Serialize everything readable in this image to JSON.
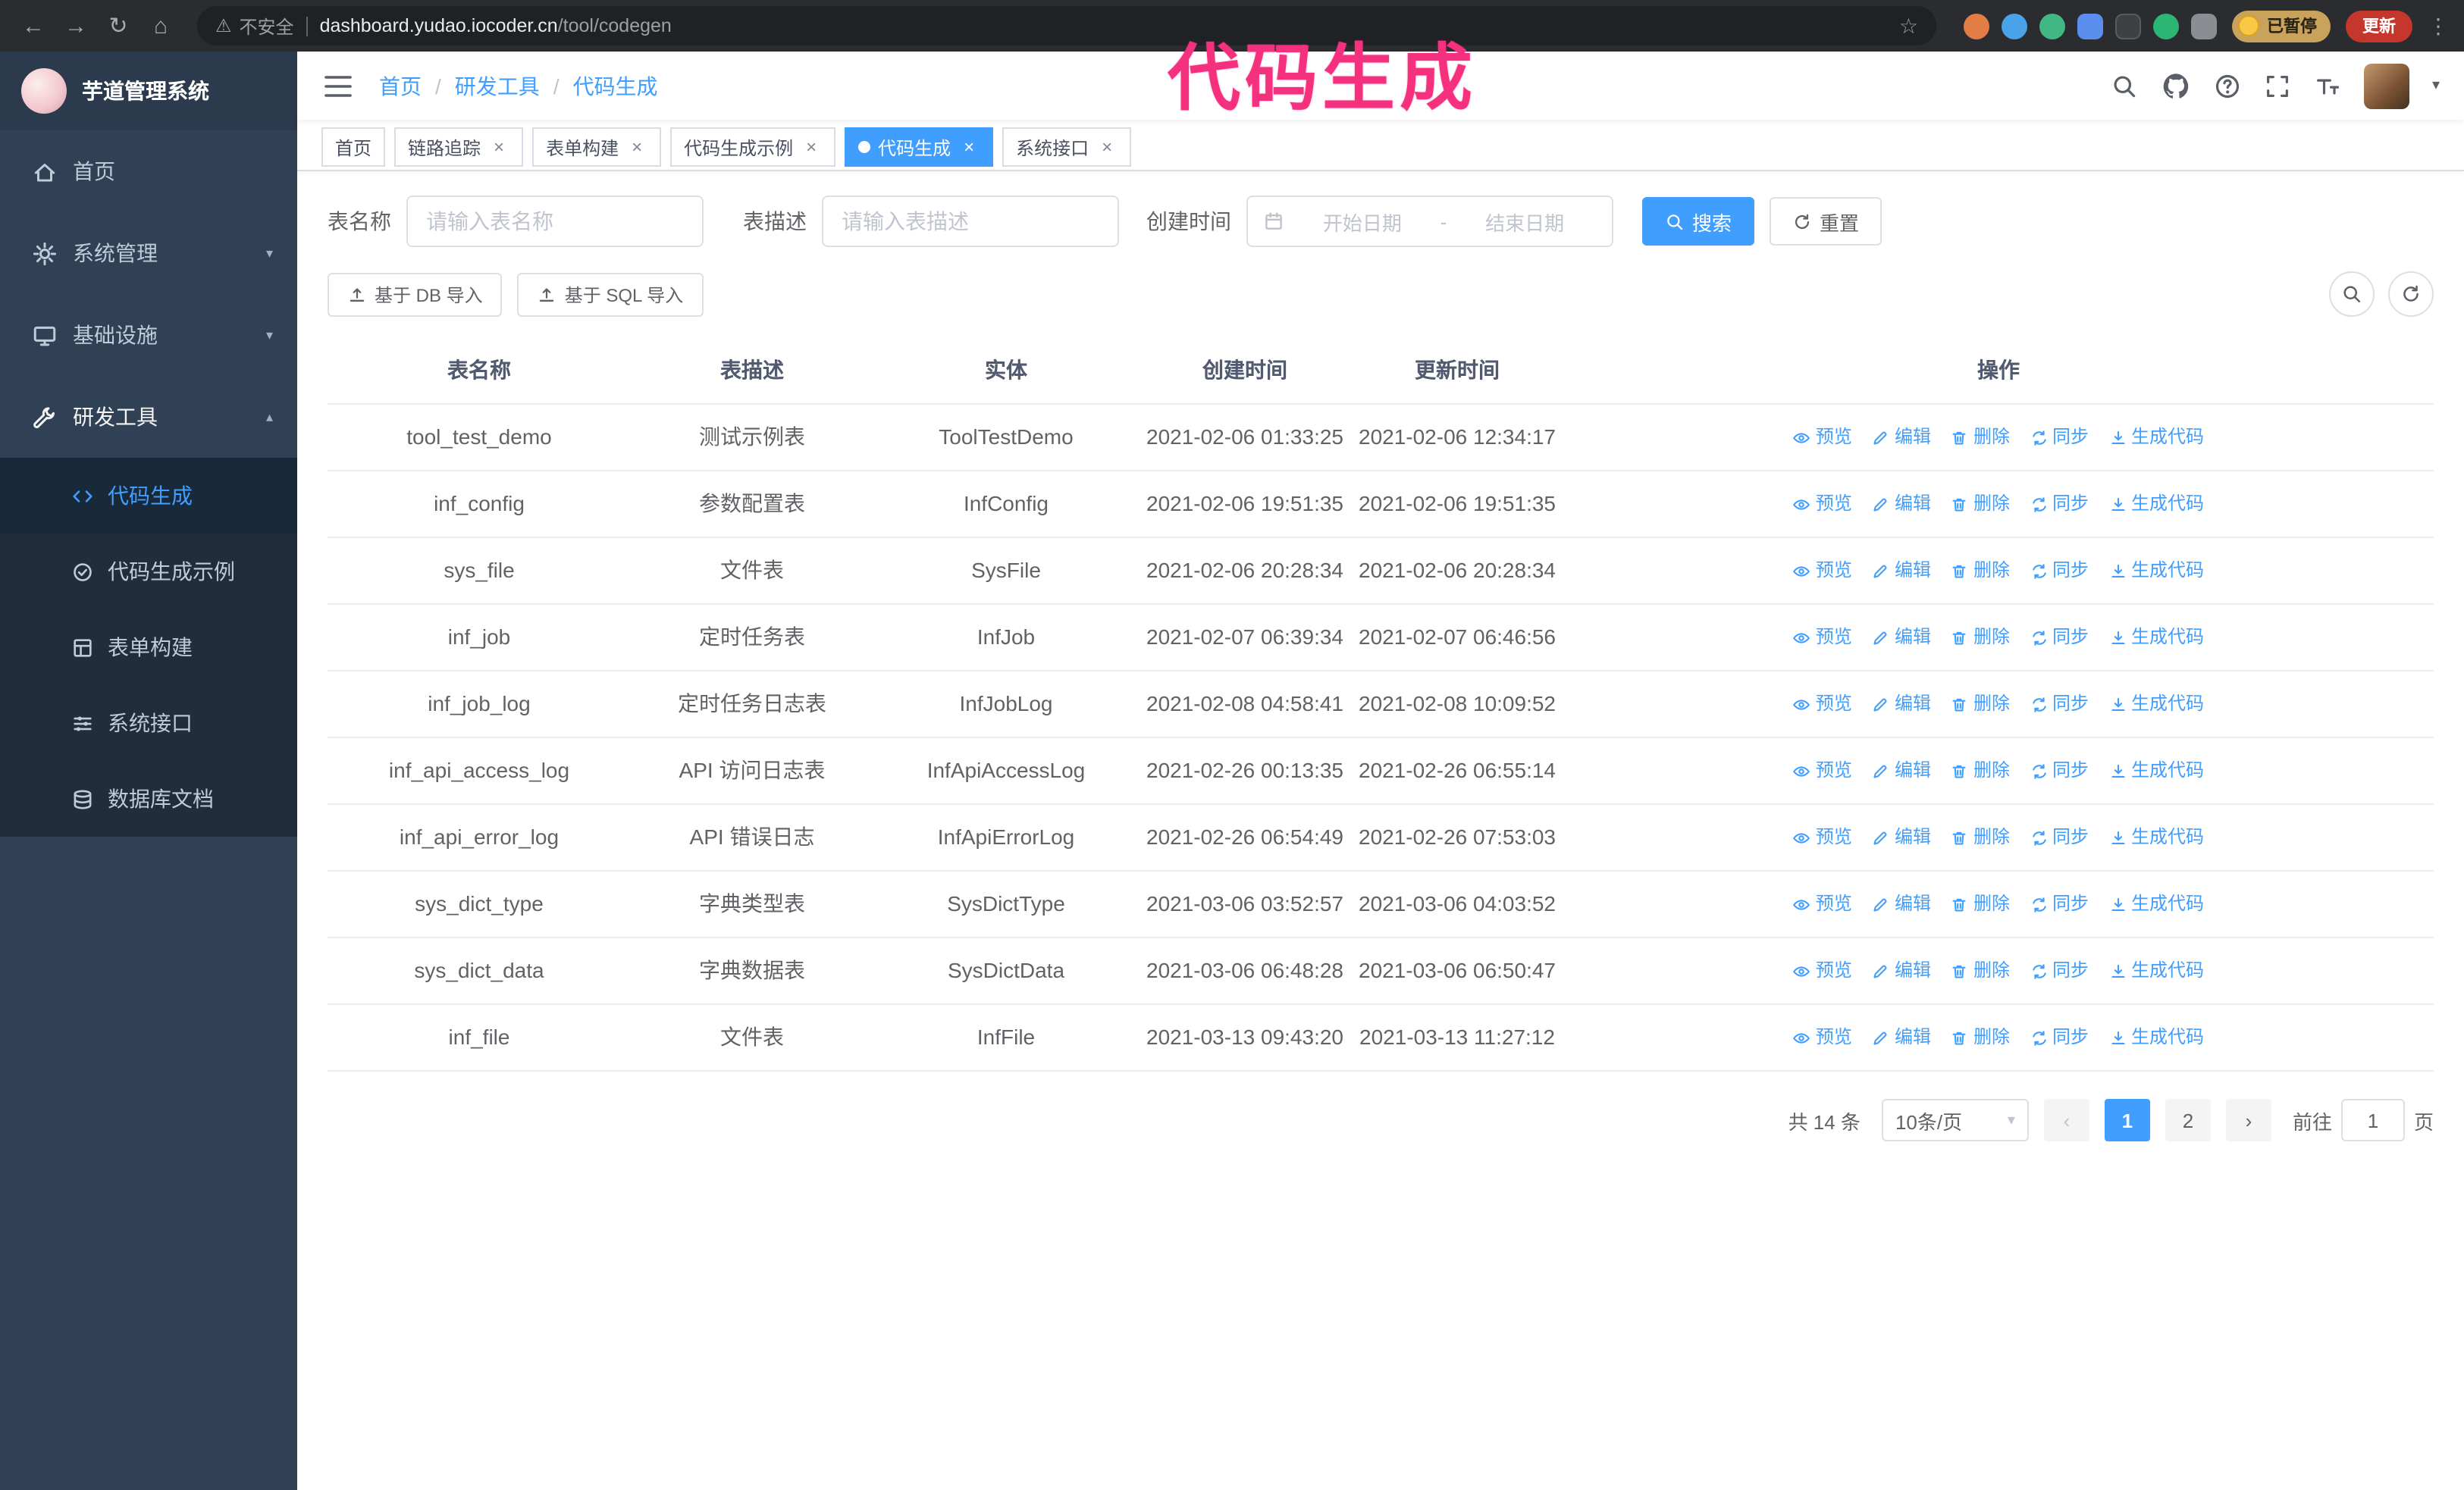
{
  "annotation": {
    "label": "代码生成",
    "color": "#f5317f"
  },
  "browser": {
    "security_label": "不安全",
    "url_host": "dashboard.yudao.iocoder.cn",
    "url_path": "/tool/codegen",
    "paused_badge": "已暂停",
    "update_button": "更新"
  },
  "sidebar": {
    "logo_title": "芋道管理系统",
    "items": [
      {
        "label": "首页",
        "icon": "home-icon",
        "chevron": ""
      },
      {
        "label": "系统管理",
        "icon": "gear-icon",
        "chevron": "down"
      },
      {
        "label": "基础设施",
        "icon": "monitor-icon",
        "chevron": "down"
      },
      {
        "label": "研发工具",
        "icon": "wrench-icon",
        "chevron": "up"
      }
    ],
    "submenu": [
      {
        "label": "代码生成",
        "icon": "code-icon",
        "active": true
      },
      {
        "label": "代码生成示例",
        "icon": "badge-icon",
        "active": false
      },
      {
        "label": "表单构建",
        "icon": "form-icon",
        "active": false
      },
      {
        "label": "系统接口",
        "icon": "api-icon",
        "active": false
      },
      {
        "label": "数据库文档",
        "icon": "database-icon",
        "active": false
      }
    ]
  },
  "header": {
    "breadcrumb": [
      "首页",
      "研发工具",
      "代码生成"
    ],
    "separator": "/"
  },
  "tabs": [
    {
      "label": "首页",
      "closable": false,
      "active": false
    },
    {
      "label": "链路追踪",
      "closable": true,
      "active": false
    },
    {
      "label": "表单构建",
      "closable": true,
      "active": false
    },
    {
      "label": "代码生成示例",
      "closable": true,
      "active": false
    },
    {
      "label": "代码生成",
      "closable": true,
      "active": true
    },
    {
      "label": "系统接口",
      "closable": true,
      "active": false
    }
  ],
  "filters": {
    "table_name_label": "表名称",
    "table_name_placeholder": "请输入表名称",
    "table_desc_label": "表描述",
    "table_desc_placeholder": "请输入表描述",
    "create_time_label": "创建时间",
    "date_start_placeholder": "开始日期",
    "date_separator": "-",
    "date_end_placeholder": "结束日期",
    "search_button": "搜索",
    "reset_button": "重置"
  },
  "toolbar": {
    "import_db_button": "基于 DB 导入",
    "import_sql_button": "基于 SQL 导入"
  },
  "table": {
    "columns": [
      "表名称",
      "表描述",
      "实体",
      "创建时间",
      "更新时间",
      "操作"
    ],
    "actions": [
      "预览",
      "编辑",
      "删除",
      "同步",
      "生成代码"
    ],
    "rows": [
      {
        "name": "tool_test_demo",
        "desc": "测试示例表",
        "entity": "ToolTestDemo",
        "created": "2021-02-06 01:33:25",
        "updated": "2021-02-06 12:34:17"
      },
      {
        "name": "inf_config",
        "desc": "参数配置表",
        "entity": "InfConfig",
        "created": "2021-02-06 19:51:35",
        "updated": "2021-02-06 19:51:35"
      },
      {
        "name": "sys_file",
        "desc": "文件表",
        "entity": "SysFile",
        "created": "2021-02-06 20:28:34",
        "updated": "2021-02-06 20:28:34"
      },
      {
        "name": "inf_job",
        "desc": "定时任务表",
        "entity": "InfJob",
        "created": "2021-02-07 06:39:34",
        "updated": "2021-02-07 06:46:56"
      },
      {
        "name": "inf_job_log",
        "desc": "定时任务日志表",
        "entity": "InfJobLog",
        "created": "2021-02-08 04:58:41",
        "updated": "2021-02-08 10:09:52"
      },
      {
        "name": "inf_api_access_log",
        "desc": "API 访问日志表",
        "entity": "InfApiAccessLog",
        "created": "2021-02-26 00:13:35",
        "updated": "2021-02-26 06:55:14"
      },
      {
        "name": "inf_api_error_log",
        "desc": "API 错误日志",
        "entity": "InfApiErrorLog",
        "created": "2021-02-26 06:54:49",
        "updated": "2021-02-26 07:53:03"
      },
      {
        "name": "sys_dict_type",
        "desc": "字典类型表",
        "entity": "SysDictType",
        "created": "2021-03-06 03:52:57",
        "updated": "2021-03-06 04:03:52"
      },
      {
        "name": "sys_dict_data",
        "desc": "字典数据表",
        "entity": "SysDictData",
        "created": "2021-03-06 06:48:28",
        "updated": "2021-03-06 06:50:47"
      },
      {
        "name": "inf_file",
        "desc": "文件表",
        "entity": "InfFile",
        "created": "2021-03-13 09:43:20",
        "updated": "2021-03-13 11:27:12"
      }
    ]
  },
  "pagination": {
    "total_text": "共 14 条",
    "page_size": "10条/页",
    "pages": [
      "1",
      "2"
    ],
    "active_page": "1",
    "goto_label": "前往",
    "goto_value": "1",
    "goto_suffix": "页"
  }
}
